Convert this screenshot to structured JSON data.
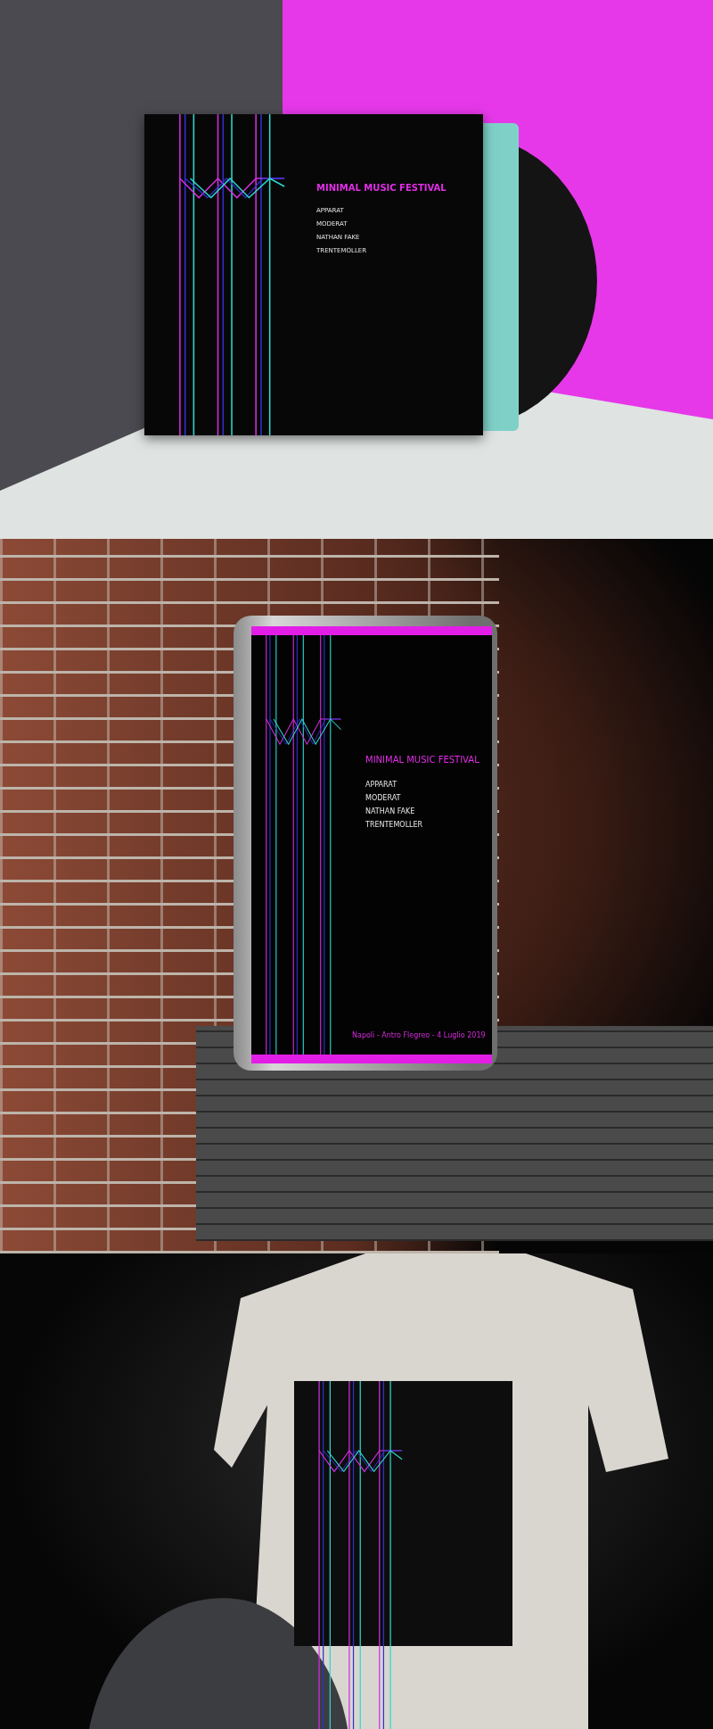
{
  "mockups": [
    {
      "kind": "vinyl",
      "title": "MINIMAL MUSIC FESTIVAL",
      "artists": [
        "APPARAT",
        "MODERAT",
        "NATHAN FAKE",
        "TRENTEMOLLER"
      ]
    },
    {
      "kind": "lightbox",
      "title": "MINIMAL MUSIC FESTIVAL",
      "artists": [
        "APPARAT",
        "MODERAT",
        "NATHAN FAKE",
        "TRENTEMOLLER"
      ],
      "footer": "Napoli - Antro Flegreo - 4 Luglio 2019"
    },
    {
      "kind": "tshirt"
    }
  ]
}
